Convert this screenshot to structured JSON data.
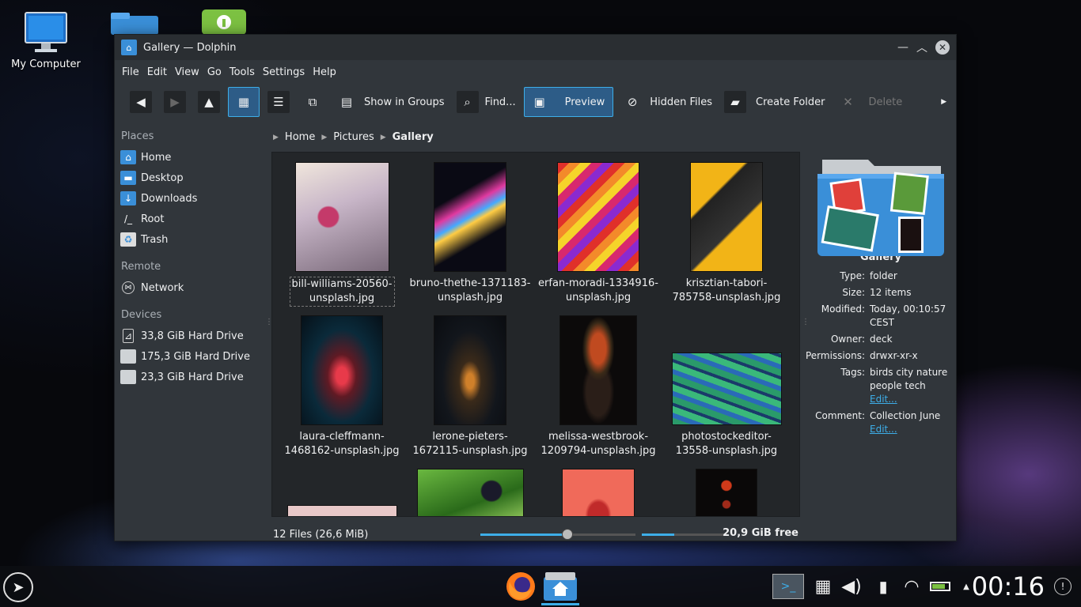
{
  "desktop": {
    "icons": [
      {
        "label": "My Computer"
      }
    ]
  },
  "window": {
    "title": "Gallery — Dolphin"
  },
  "menu": [
    "File",
    "Edit",
    "View",
    "Go",
    "Tools",
    "Settings",
    "Help"
  ],
  "toolbar": {
    "show_in_groups": "Show in Groups",
    "find": "Find...",
    "preview": "Preview",
    "hidden_files": "Hidden Files",
    "create_folder": "Create Folder",
    "delete": "Delete"
  },
  "places": {
    "header": "Places",
    "items": [
      "Home",
      "Desktop",
      "Downloads",
      "Root",
      "Trash"
    ],
    "remote_header": "Remote",
    "remote_items": [
      "Network"
    ],
    "devices_header": "Devices",
    "devices": [
      "33,8 GiB Hard Drive",
      "175,3 GiB Hard Drive",
      "23,3 GiB Hard Drive"
    ]
  },
  "breadcrumb": [
    "Home",
    "Pictures",
    "Gallery"
  ],
  "files": [
    {
      "line1": "bill-williams-20560-",
      "line2": "unsplash.jpg"
    },
    {
      "line1": "bruno-thethe-1371183-",
      "line2": "unsplash.jpg"
    },
    {
      "line1": "erfan-moradi-1334916-",
      "line2": "unsplash.jpg"
    },
    {
      "line1": "krisztian-tabori-",
      "line2": "785758-unsplash.jpg"
    },
    {
      "line1": "laura-cleffmann-",
      "line2": "1468162-unsplash.jpg"
    },
    {
      "line1": "lerone-pieters-",
      "line2": "1672115-unsplash.jpg"
    },
    {
      "line1": "melissa-westbrook-",
      "line2": "1209794-unsplash.jpg"
    },
    {
      "line1": "photostockeditor-",
      "line2": "13558-unsplash.jpg"
    }
  ],
  "status": {
    "count": "12 Files (26,6 MiB)",
    "free": "20,9 GiB free",
    "zoom_fraction": 0.56,
    "used_fraction": 0.38
  },
  "info": {
    "name": "Gallery",
    "type_k": "Type:",
    "type_v": "folder",
    "size_k": "Size:",
    "size_v": "12 items",
    "modified_k": "Modified:",
    "modified_v": "Today, 00:10:57",
    "modified_v2": "CEST",
    "owner_k": "Owner:",
    "owner_v": "deck",
    "perm_k": "Permissions:",
    "perm_v": "drwxr-xr-x",
    "tags_k": "Tags:",
    "tags_v": "birds city nature",
    "tags_v2": "people tech",
    "edit": "Edit...",
    "comment_k": "Comment:",
    "comment_v": "Collection June"
  },
  "taskbar": {
    "clock": "00:16"
  }
}
